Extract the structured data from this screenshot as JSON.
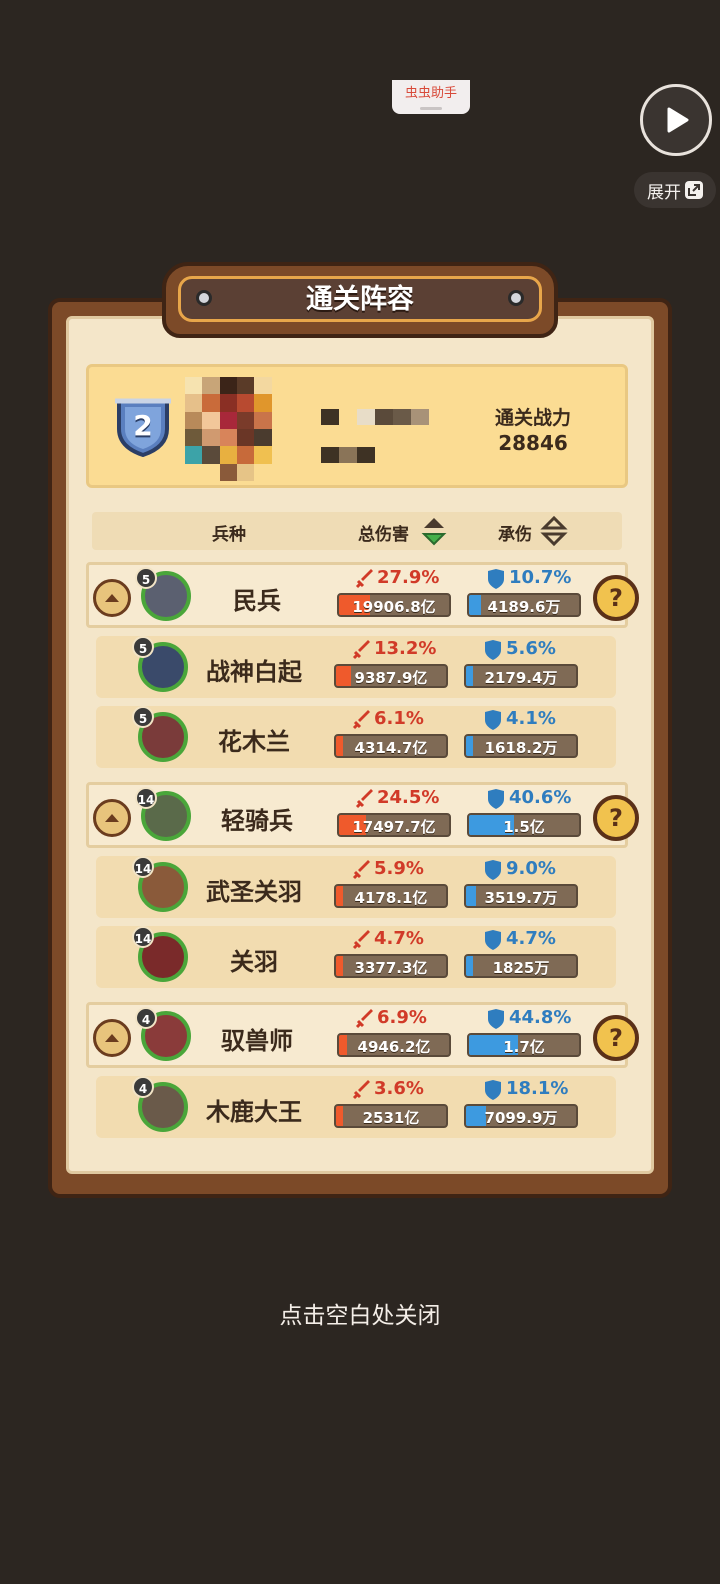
{
  "overlay": {
    "assistant_tab": "虫虫助手",
    "expand_label": "展开"
  },
  "panel": {
    "title": "通关阵容",
    "rank": "2",
    "power_label": "通关战力",
    "power_value": "28846",
    "columns": {
      "unit": "兵种",
      "damage": "总伤害",
      "tank": "承伤"
    }
  },
  "groups": [
    {
      "main": {
        "level": "5",
        "name": "民兵",
        "dmg_pct": "27.9%",
        "dmg_fill": 0.279,
        "dmg_val": "19906.8亿",
        "tank_pct": "10.7%",
        "tank_fill": 0.107,
        "tank_val": "4189.6万"
      },
      "subs": [
        {
          "level": "5",
          "name": "战神白起",
          "dmg_pct": "13.2%",
          "dmg_fill": 0.132,
          "dmg_val": "9387.9亿",
          "tank_pct": "5.6%",
          "tank_fill": 0.056,
          "tank_val": "2179.4万"
        },
        {
          "level": "5",
          "name": "花木兰",
          "dmg_pct": "6.1%",
          "dmg_fill": 0.061,
          "dmg_val": "4314.7亿",
          "tank_pct": "4.1%",
          "tank_fill": 0.041,
          "tank_val": "1618.2万"
        }
      ]
    },
    {
      "main": {
        "level": "14",
        "name": "轻骑兵",
        "dmg_pct": "24.5%",
        "dmg_fill": 0.245,
        "dmg_val": "17497.7亿",
        "tank_pct": "40.6%",
        "tank_fill": 0.406,
        "tank_val": "1.5亿"
      },
      "subs": [
        {
          "level": "14",
          "name": "武圣关羽",
          "dmg_pct": "5.9%",
          "dmg_fill": 0.059,
          "dmg_val": "4178.1亿",
          "tank_pct": "9.0%",
          "tank_fill": 0.09,
          "tank_val": "3519.7万"
        },
        {
          "level": "14",
          "name": "关羽",
          "dmg_pct": "4.7%",
          "dmg_fill": 0.047,
          "dmg_val": "3377.3亿",
          "tank_pct": "4.7%",
          "tank_fill": 0.047,
          "tank_val": "1825万"
        }
      ]
    },
    {
      "main": {
        "level": "4",
        "name": "驭兽师",
        "dmg_pct": "6.9%",
        "dmg_fill": 0.069,
        "dmg_val": "4946.2亿",
        "tank_pct": "44.8%",
        "tank_fill": 0.448,
        "tank_val": "1.7亿"
      },
      "subs": [
        {
          "level": "4",
          "name": "木鹿大王",
          "dmg_pct": "3.6%",
          "dmg_fill": 0.036,
          "dmg_val": "2531亿",
          "tank_pct": "18.1%",
          "tank_fill": 0.181,
          "tank_val": "7099.9万"
        }
      ]
    }
  ],
  "close_hint": "点击空白处关闭",
  "colors": {
    "damage_red": "#d13a28",
    "tank_blue": "#2f7dbf",
    "panel_wood": "#7c4a28",
    "parchment": "#f4e6c9"
  }
}
